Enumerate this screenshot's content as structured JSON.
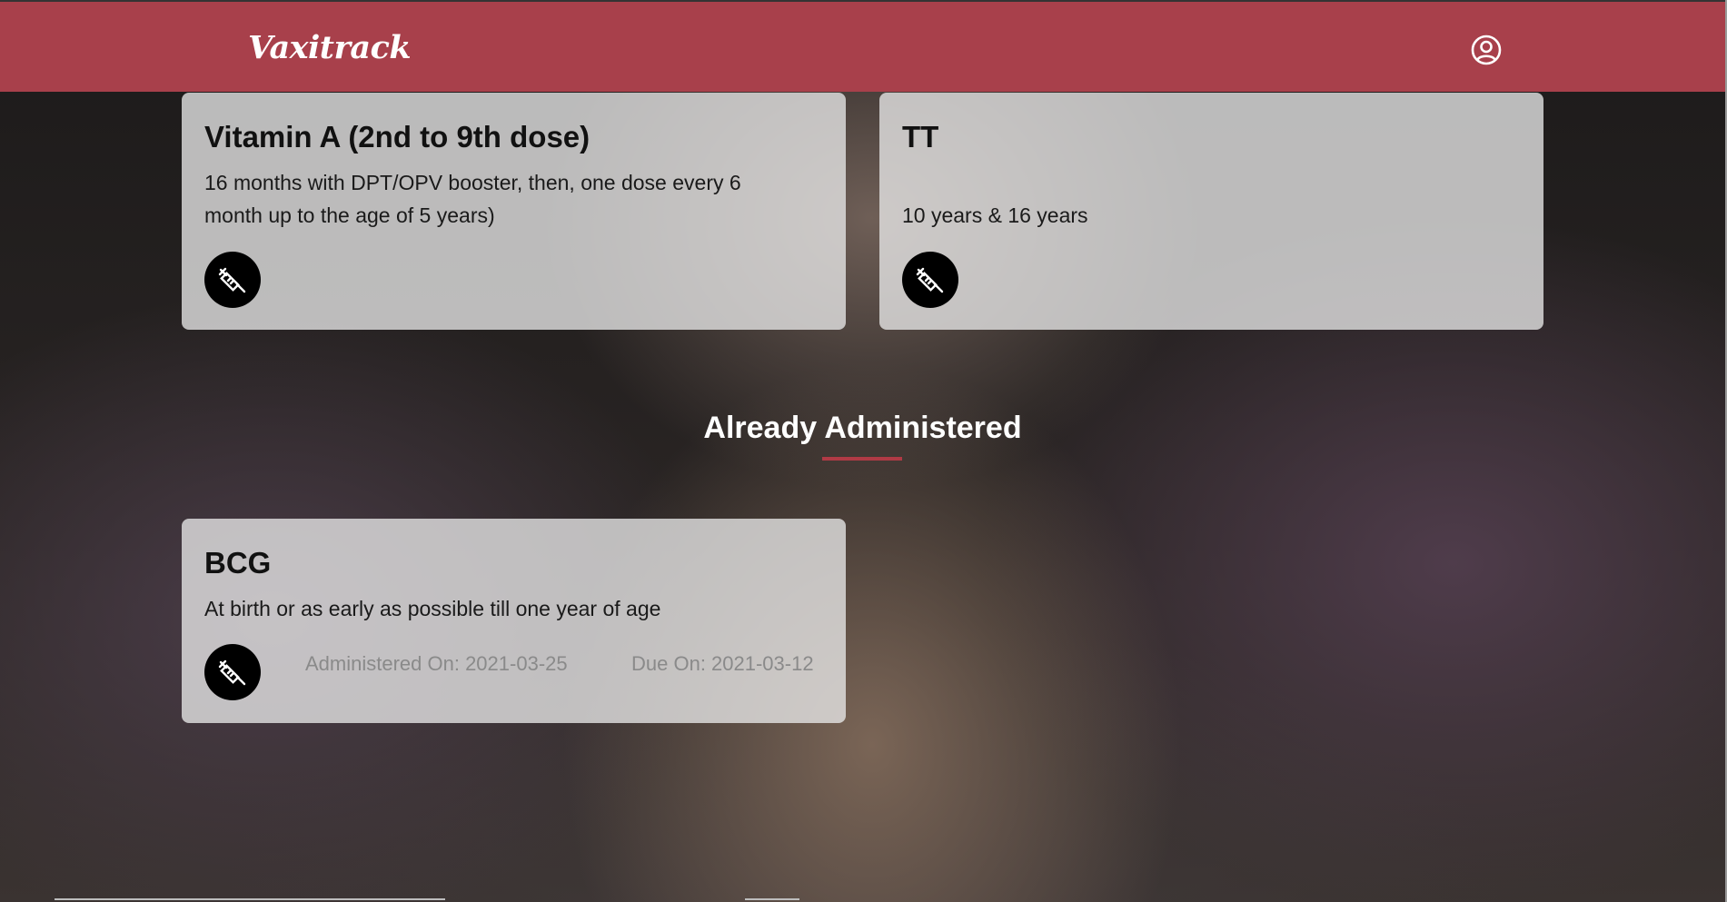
{
  "header": {
    "logo": "Vaxitrack",
    "profile_icon": "user-circle-icon",
    "background_color": "#a8404b"
  },
  "upcoming": [
    {
      "title": "Vitamin A (2nd to 9th dose)",
      "description": "16 months with DPT/OPV booster, then, one dose every 6 month up to the age of 5 years)",
      "icon": "syringe-icon"
    },
    {
      "title": "TT",
      "description": "10 years & 16 years",
      "icon": "syringe-icon"
    }
  ],
  "administered_section": {
    "heading": "Already Administered",
    "accent_color": "#b03a45",
    "items": [
      {
        "title": "BCG",
        "description": "At birth or as early as possible till one year of age",
        "administered_on": "Administered On: 2021-03-25",
        "due_on": "Due On: 2021-03-12",
        "icon": "syringe-icon"
      }
    ]
  }
}
